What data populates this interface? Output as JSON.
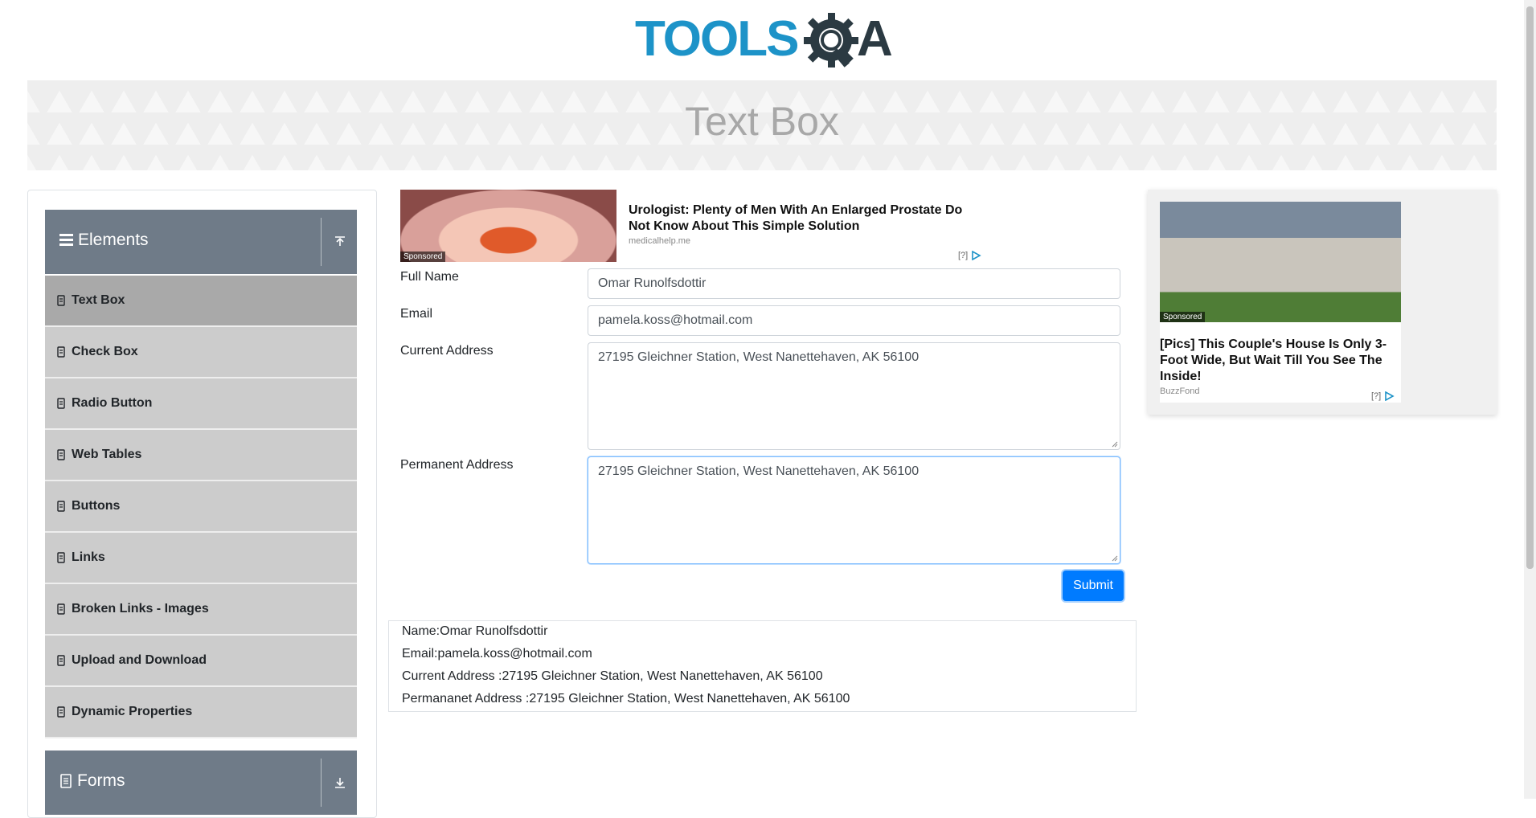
{
  "header": {
    "logo_text": "TOOLS",
    "logo_suffix": "A"
  },
  "banner": {
    "title": "Text Box"
  },
  "sidebar": {
    "groups": [
      {
        "title": "Elements",
        "expanded": true
      },
      {
        "title": "Forms",
        "expanded": false
      }
    ],
    "items": [
      {
        "label": "Text Box",
        "active": true
      },
      {
        "label": "Check Box"
      },
      {
        "label": "Radio Button"
      },
      {
        "label": "Web Tables"
      },
      {
        "label": "Buttons"
      },
      {
        "label": "Links"
      },
      {
        "label": "Broken Links - Images"
      },
      {
        "label": "Upload and Download"
      },
      {
        "label": "Dynamic Properties"
      }
    ]
  },
  "ad_top": {
    "sponsored": "Sponsored",
    "title": "Urologist: Plenty of Men With An Enlarged Prostate Do Not Know About This Simple Solution",
    "source": "medicalhelp.me",
    "choice": "[?]"
  },
  "form": {
    "full_name_label": "Full Name",
    "full_name_value": "Omar Runolfsdottir",
    "email_label": "Email",
    "email_value": "pamela.koss@hotmail.com",
    "current_address_label": "Current Address",
    "current_address_value": "27195 Gleichner Station, West Nanettehaven, AK 56100",
    "permanent_address_label": "Permanent Address",
    "permanent_address_value": "27195 Gleichner Station, West Nanettehaven, AK 56100",
    "submit_label": "Submit"
  },
  "output": {
    "name": "Name:Omar Runolfsdottir",
    "email": "Email:pamela.koss@hotmail.com",
    "current_address": "Current Address :27195 Gleichner Station, West Nanettehaven, AK 56100",
    "permanent_address": "Permananet Address :27195 Gleichner Station, West Nanettehaven, AK 56100"
  },
  "ad_right": {
    "sponsored": "Sponsored",
    "title": "[Pics] This Couple's House Is Only 3-Foot Wide, But Wait Till You See The Inside!",
    "source": "BuzzFond",
    "choice": "[?]"
  },
  "colors": {
    "accent": "#007bff",
    "sidebar_header": "#6f7b88",
    "menu_bg": "#cccccc",
    "menu_active": "#a9a9a9",
    "logo_blue": "#1d93c8"
  }
}
